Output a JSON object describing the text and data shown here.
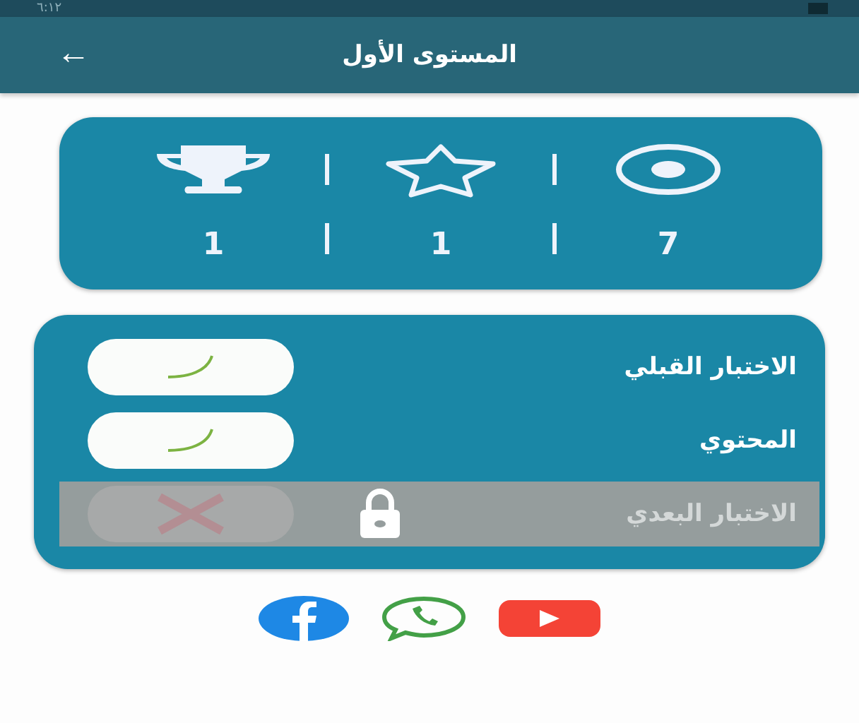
{
  "status_bar": {
    "time": "٦:١٢"
  },
  "app_bar": {
    "title": "المستوى الأول",
    "back": "←"
  },
  "stats": [
    {
      "kind": "target",
      "value": "7"
    },
    {
      "kind": "star",
      "value": "1"
    },
    {
      "kind": "trophy",
      "value": "1"
    }
  ],
  "lessons": [
    {
      "title": "الاختبار القبلي",
      "locked": false
    },
    {
      "title": "المحتوي",
      "locked": false
    },
    {
      "title": "الاختبار البعدي",
      "locked": true
    }
  ],
  "social": [
    {
      "kind": "facebook"
    },
    {
      "kind": "whatsapp"
    },
    {
      "kind": "youtube"
    }
  ]
}
